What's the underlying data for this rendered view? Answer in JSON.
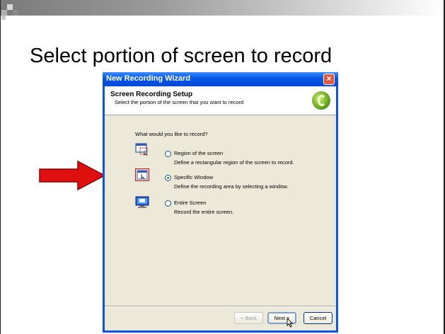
{
  "slide": {
    "title": "Select portion of screen to record"
  },
  "wizard": {
    "window_title": "New Recording Wizard",
    "close_glyph": "×",
    "header_title": "Screen Recording Setup",
    "header_subtitle": "Select the portion of the screen that you want to record",
    "question": "What would you like to record?",
    "options": [
      {
        "label": "Region of the screen",
        "description": "Define a rectangular region of the screen to record.",
        "selected": false,
        "icon": "region-icon"
      },
      {
        "label": "Specific Window",
        "description": "Define the recording area by selecting a window.",
        "selected": true,
        "icon": "window-icon"
      },
      {
        "label": "Entire Screen",
        "description": "Record the entire screen.",
        "selected": false,
        "icon": "monitor-icon"
      }
    ],
    "buttons": {
      "back": "< Back",
      "next": "Next >",
      "cancel": "Cancel"
    }
  },
  "colors": {
    "xp_blue": "#0a55e8",
    "dialog_bg": "#ece9d8",
    "arrow_red": "#e01010",
    "radio_dot": "#21a121"
  }
}
